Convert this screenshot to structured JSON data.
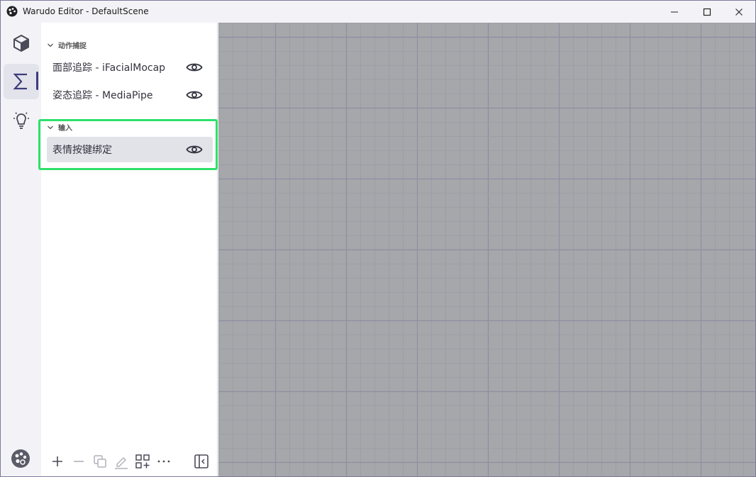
{
  "window": {
    "title": "Warudo Editor - DefaultScene",
    "icons": [
      "app-logo-icon",
      "minimize-icon",
      "maximize-icon",
      "close-icon"
    ]
  },
  "rail": {
    "items": [
      {
        "name": "scene",
        "icon": "cube-icon",
        "active": false
      },
      {
        "name": "blueprints",
        "icon": "sigma-icon",
        "active": true
      },
      {
        "name": "plugins",
        "icon": "lightbulb-icon",
        "active": false
      }
    ],
    "bottom_icon": "palette-icon"
  },
  "panel": {
    "groups": [
      {
        "header": "动作捕捉",
        "items": [
          {
            "label": "面部追踪 - iFacialMocap",
            "icon": "eye-icon",
            "selected": false
          },
          {
            "label": "姿态追踪 - MediaPipe",
            "icon": "eye-icon",
            "selected": false
          }
        ]
      },
      {
        "header": "输入",
        "items": [
          {
            "label": "表情按键绑定",
            "icon": "eye-icon",
            "selected": true
          }
        ]
      }
    ],
    "highlight_color": "#2ee06a",
    "toolbar": [
      "add-icon",
      "remove-icon",
      "duplicate-icon",
      "rename-icon",
      "add-grid-icon",
      "more-icon",
      "collapse-panel-icon"
    ]
  },
  "canvas": {
    "background": "#a6a7ab",
    "grid_minor": "#9b9ca3",
    "grid_major": "#8d8fa0"
  }
}
